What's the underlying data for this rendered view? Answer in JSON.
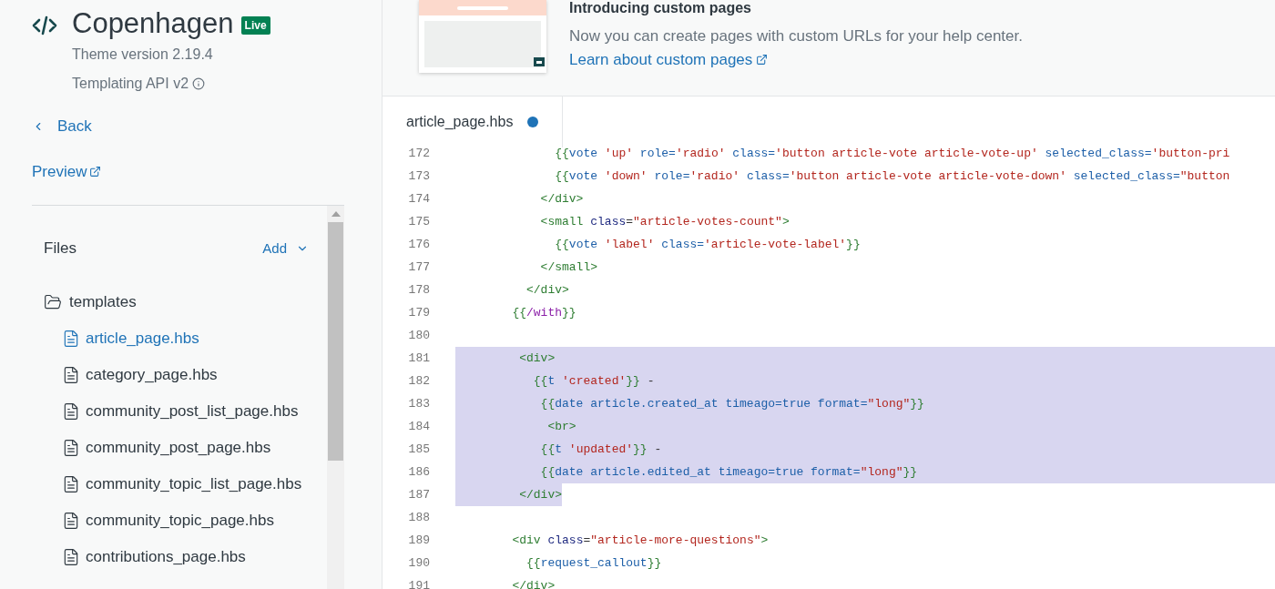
{
  "theme": {
    "name": "Copenhagen",
    "badge": "Live",
    "version": "Theme version 2.19.4",
    "api": "Templating API v2"
  },
  "nav": {
    "back": "Back",
    "preview": "Preview"
  },
  "files": {
    "title": "Files",
    "add": "Add",
    "folders": [
      {
        "name": "templates",
        "expanded": true,
        "children": [
          {
            "name": "article_page.hbs",
            "selected": true
          },
          {
            "name": "category_page.hbs",
            "selected": false
          },
          {
            "name": "community_post_list_page.hbs",
            "selected": false
          },
          {
            "name": "community_post_page.hbs",
            "selected": false
          },
          {
            "name": "community_topic_list_page.hbs",
            "selected": false
          },
          {
            "name": "community_topic_page.hbs",
            "selected": false
          },
          {
            "name": "contributions_page.hbs",
            "selected": false
          }
        ]
      }
    ]
  },
  "banner": {
    "title": "Introducing custom pages",
    "text": "Now you can create pages with custom URLs for your help center.",
    "link": "Learn about custom pages"
  },
  "tabs": [
    {
      "label": "article_page.hbs",
      "selected": true,
      "modified": true
    }
  ],
  "code": [
    {
      "number": "172",
      "selected": false,
      "tokens": [
        {
          "kind": "tag",
          "text": "              {{"
        },
        {
          "kind": "helper",
          "text": "vote "
        },
        {
          "kind": "string",
          "text": "'up'"
        },
        {
          "kind": "helper",
          "text": " role="
        },
        {
          "kind": "string",
          "text": "'radio'"
        },
        {
          "kind": "helper",
          "text": " class="
        },
        {
          "kind": "string",
          "text": "'button article-vote article-vote-up'"
        },
        {
          "kind": "helper",
          "text": " selected_class="
        },
        {
          "kind": "string",
          "text": "'button-pri"
        }
      ]
    },
    {
      "number": "173",
      "selected": false,
      "tokens": [
        {
          "kind": "tag",
          "text": "              {{"
        },
        {
          "kind": "helper",
          "text": "vote "
        },
        {
          "kind": "string",
          "text": "'down'"
        },
        {
          "kind": "helper",
          "text": " role="
        },
        {
          "kind": "string",
          "text": "'radio'"
        },
        {
          "kind": "helper",
          "text": " class="
        },
        {
          "kind": "string",
          "text": "'button article-vote article-vote-down'"
        },
        {
          "kind": "helper",
          "text": " selected_class="
        },
        {
          "kind": "string",
          "text": "\"button"
        }
      ]
    },
    {
      "number": "174",
      "selected": false,
      "tokens": [
        {
          "kind": "tag",
          "text": "            </div>"
        }
      ]
    },
    {
      "number": "175",
      "selected": false,
      "tokens": [
        {
          "kind": "tag",
          "text": "            <small"
        },
        {
          "kind": "attr",
          "text": " class"
        },
        {
          "kind": "plain",
          "text": "="
        },
        {
          "kind": "string",
          "text": "\"article-votes-count\""
        },
        {
          "kind": "tag",
          "text": ">"
        }
      ]
    },
    {
      "number": "176",
      "selected": false,
      "tokens": [
        {
          "kind": "tag",
          "text": "              {{"
        },
        {
          "kind": "helper",
          "text": "vote "
        },
        {
          "kind": "string",
          "text": "'label'"
        },
        {
          "kind": "helper",
          "text": " class="
        },
        {
          "kind": "string",
          "text": "'article-vote-label'"
        },
        {
          "kind": "tag",
          "text": "}}"
        }
      ]
    },
    {
      "number": "177",
      "selected": false,
      "tokens": [
        {
          "kind": "tag",
          "text": "            </small>"
        }
      ]
    },
    {
      "number": "178",
      "selected": false,
      "tokens": [
        {
          "kind": "tag",
          "text": "          </div>"
        }
      ]
    },
    {
      "number": "179",
      "selected": false,
      "tokens": [
        {
          "kind": "tag",
          "text": "        {{"
        },
        {
          "kind": "keyword",
          "text": "/with"
        },
        {
          "kind": "tag",
          "text": "}}"
        }
      ]
    },
    {
      "number": "180",
      "selected": false
    },
    {
      "number": "181",
      "selected": true,
      "tokens": [
        {
          "kind": "tag",
          "text": "         <div>"
        }
      ]
    },
    {
      "number": "182",
      "selected": true,
      "tokens": [
        {
          "kind": "tag",
          "text": "           {{"
        },
        {
          "kind": "helper",
          "text": "t "
        },
        {
          "kind": "string",
          "text": "'created'"
        },
        {
          "kind": "tag",
          "text": "}}"
        },
        {
          "kind": "plain",
          "text": " -"
        }
      ]
    },
    {
      "number": "183",
      "selected": true,
      "tokens": [
        {
          "kind": "tag",
          "text": "            {{"
        },
        {
          "kind": "helper",
          "text": "date article.created_at timeago=true format="
        },
        {
          "kind": "string",
          "text": "\"long\""
        },
        {
          "kind": "tag",
          "text": "}}"
        }
      ]
    },
    {
      "number": "184",
      "selected": true,
      "tokens": [
        {
          "kind": "tag",
          "text": "             <br>"
        }
      ]
    },
    {
      "number": "185",
      "selected": true,
      "tokens": [
        {
          "kind": "tag",
          "text": "            {{"
        },
        {
          "kind": "helper",
          "text": "t "
        },
        {
          "kind": "string",
          "text": "'updated'"
        },
        {
          "kind": "tag",
          "text": "}}"
        },
        {
          "kind": "plain",
          "text": " -"
        }
      ]
    },
    {
      "number": "186",
      "selected": true,
      "tokens": [
        {
          "kind": "tag",
          "text": "            {{"
        },
        {
          "kind": "helper",
          "text": "date article.edited_at timeago=true format="
        },
        {
          "kind": "string",
          "text": "\"long\""
        },
        {
          "kind": "tag",
          "text": "}}"
        }
      ]
    },
    {
      "number": "187",
      "selected": true,
      "tokens": [
        {
          "kind": "tag",
          "text": "         </div>"
        }
      ]
    },
    {
      "number": "188",
      "selected": false
    },
    {
      "number": "189",
      "selected": false,
      "tokens": [
        {
          "kind": "tag",
          "text": "        <div"
        },
        {
          "kind": "attr",
          "text": " class"
        },
        {
          "kind": "plain",
          "text": "="
        },
        {
          "kind": "string",
          "text": "\"article-more-questions\""
        },
        {
          "kind": "tag",
          "text": ">"
        }
      ]
    },
    {
      "number": "190",
      "selected": false,
      "tokens": [
        {
          "kind": "tag",
          "text": "          {{"
        },
        {
          "kind": "helper",
          "text": "request_callout"
        },
        {
          "kind": "tag",
          "text": "}}"
        }
      ]
    },
    {
      "number": "191",
      "selected": false,
      "tokens": [
        {
          "kind": "tag",
          "text": "        </div>"
        }
      ]
    }
  ]
}
